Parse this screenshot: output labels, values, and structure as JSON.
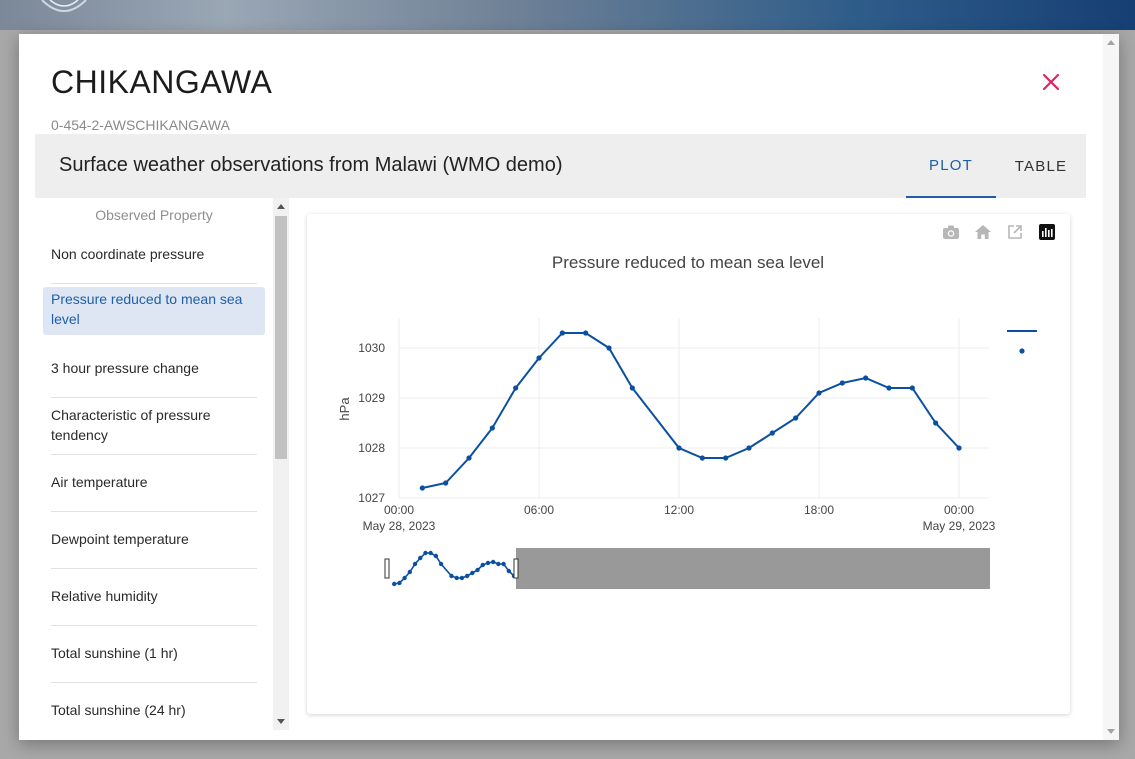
{
  "station": {
    "name": "CHIKANGAWA",
    "id": "0-454-2-AWSCHIKANGAWA"
  },
  "collection": {
    "title": "Surface weather observations from Malawi (WMO demo)"
  },
  "tabs": {
    "plot": "PLOT",
    "table": "TABLE",
    "active": "PLOT"
  },
  "sidebar": {
    "header": "Observed Property",
    "items": [
      {
        "label": "Non coordinate pressure"
      },
      {
        "label": "Pressure reduced to mean sea level",
        "active": true
      },
      {
        "label": "3 hour pressure change"
      },
      {
        "label": "Characteristic of pressure tendency"
      },
      {
        "label": "Air temperature"
      },
      {
        "label": "Dewpoint temperature"
      },
      {
        "label": "Relative humidity"
      },
      {
        "label": "Total sunshine (1 hr)"
      },
      {
        "label": "Total sunshine (24 hr)"
      }
    ]
  },
  "modebar": {
    "icons": [
      "camera-icon",
      "home-icon",
      "external-link-icon",
      "plotly-logo-icon"
    ]
  },
  "colors": {
    "accent": "#1f5fa8",
    "close": "#e0245e",
    "series": "#0b4fa1"
  },
  "chart_data": {
    "type": "line",
    "title": "Pressure reduced to mean sea level",
    "ylabel": "hPa",
    "xlabel": "",
    "ylim": [
      1027,
      1030.6
    ],
    "xlim": [
      "2023-05-28 00:00",
      "2023-05-29 00:00"
    ],
    "xticks": [
      {
        "label": "00:00",
        "sublabel": "May 28, 2023",
        "hour": 0
      },
      {
        "label": "06:00",
        "sublabel": "",
        "hour": 6
      },
      {
        "label": "12:00",
        "sublabel": "",
        "hour": 12
      },
      {
        "label": "18:00",
        "sublabel": "",
        "hour": 18
      },
      {
        "label": "00:00",
        "sublabel": "May 29, 2023",
        "hour": 24
      }
    ],
    "yticks": [
      1027,
      1028,
      1029,
      1030
    ],
    "grid": true,
    "legend": "top-right",
    "series": [
      {
        "x": [
          "2023-05-28 01:00",
          "2023-05-28 02:00",
          "2023-05-28 03:00",
          "2023-05-28 04:00",
          "2023-05-28 05:00",
          "2023-05-28 06:00",
          "2023-05-28 07:00",
          "2023-05-28 08:00",
          "2023-05-28 09:00",
          "2023-05-28 10:00",
          "2023-05-28 12:00",
          "2023-05-28 13:00",
          "2023-05-28 14:00",
          "2023-05-28 15:00",
          "2023-05-28 16:00",
          "2023-05-28 17:00",
          "2023-05-28 18:00",
          "2023-05-28 19:00",
          "2023-05-28 20:00",
          "2023-05-28 21:00",
          "2023-05-28 22:00",
          "2023-05-28 23:00",
          "2023-05-29 00:00"
        ],
        "y": [
          1027.2,
          1027.3,
          1027.8,
          1028.4,
          1029.2,
          1029.8,
          1030.3,
          1030.3,
          1030.0,
          1029.2,
          1028.0,
          1027.8,
          1027.8,
          1028.0,
          1028.3,
          1028.6,
          1029.1,
          1029.3,
          1029.4,
          1029.2,
          1029.2,
          1028.5,
          1028.0
        ]
      }
    ],
    "rangeslider": {
      "visible": true,
      "selected": [
        "2023-05-28 00:00",
        "2023-05-29 00:00"
      ]
    }
  }
}
